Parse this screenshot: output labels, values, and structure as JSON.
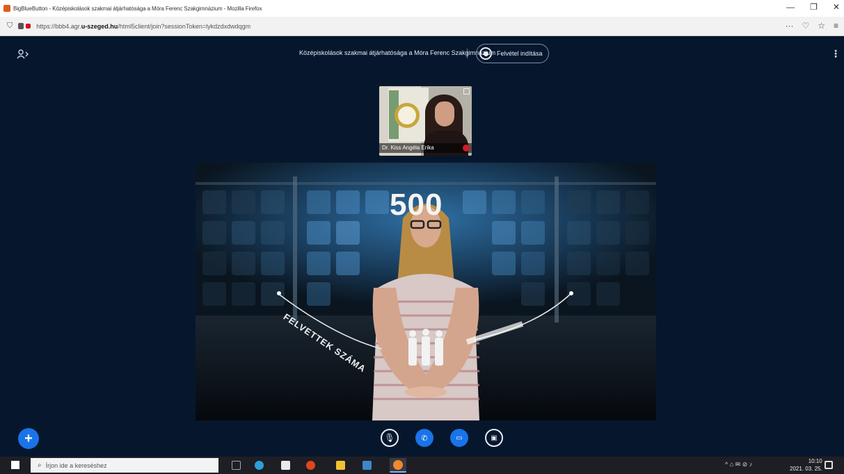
{
  "browser": {
    "window_title": "BigBlueButton - Középiskolások szakmai átjárhatósága a Móra Ferenc Szakgimnázium - Mozilla Firefox",
    "url_prefix": "https://bbb4.agr.",
    "url_domain": "u-szeged.hu",
    "url_suffix": "/html5client/join?sessionToken=lykdzdxdwdqgm",
    "window_controls": [
      "—",
      "❐",
      "✕"
    ],
    "toolbar_icons": [
      "···",
      "♡",
      "☆",
      "≡"
    ]
  },
  "meeting": {
    "title": "Középiskolások szakmai átjárhatósága a Móra Ferenc Szakgimnázium",
    "record_label": "Felvétel indítása",
    "webcam_name": "Dr. Kiss Angéla Erika",
    "video_number": "500",
    "video_arc_text": "FELVETTEK SZÁMA"
  },
  "controls": {
    "add": "+",
    "mic": "🎙",
    "phone": "✆",
    "camera": "▭",
    "share": "▣"
  },
  "taskbar": {
    "search_placeholder": "Írjon ide a kereséshez",
    "tray_text": "^ ⌂ ✉ ⊘ ♪",
    "clock_time": "10:10",
    "clock_date": "2021. 03. 25."
  },
  "colors": {
    "meeting_bg": "#06172d",
    "accent_blue": "#1a73e8",
    "mute_red": "#d21c2a"
  }
}
